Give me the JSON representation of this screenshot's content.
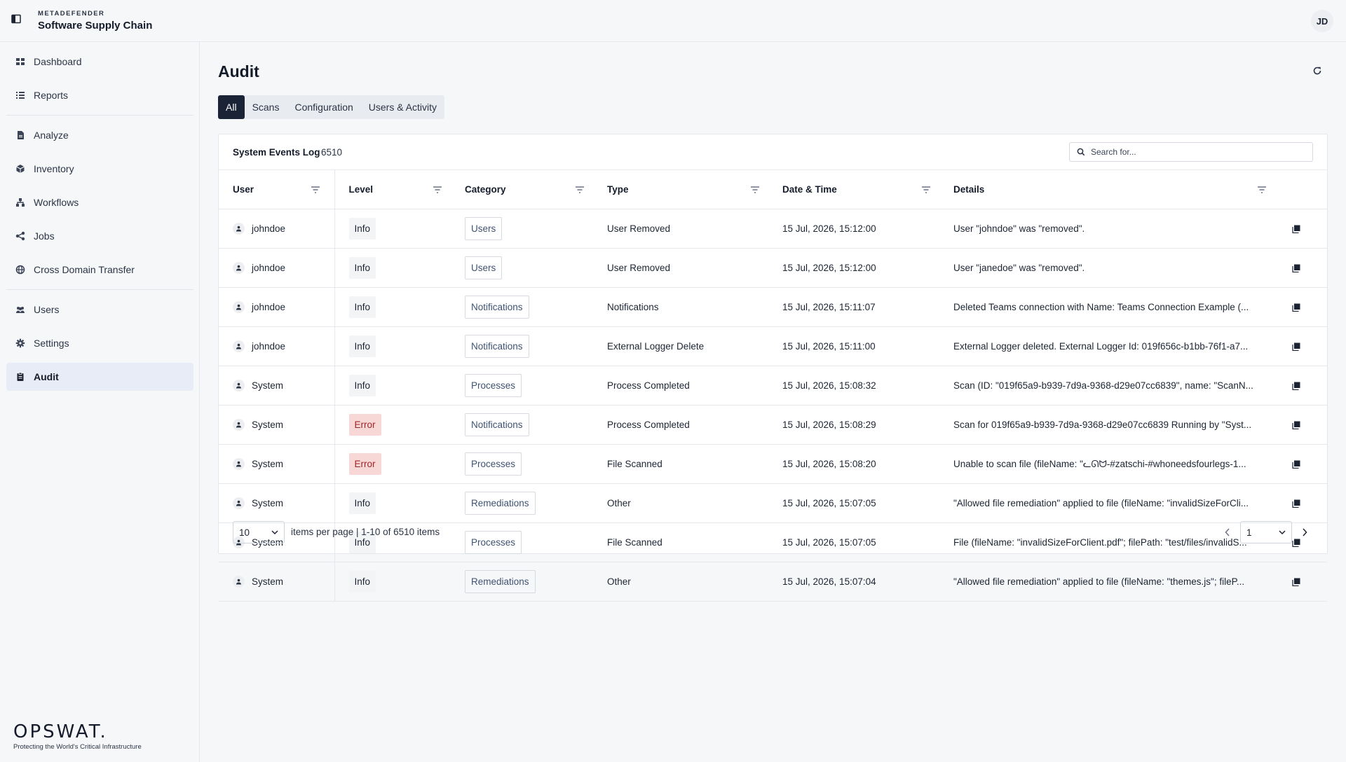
{
  "brand": {
    "over": "METADEFENDER",
    "name": "Software Supply Chain"
  },
  "user_initials": "JD",
  "sidebar": {
    "items": [
      {
        "label": "Dashboard",
        "icon": "dashboard-icon"
      },
      {
        "label": "Reports",
        "icon": "list-icon"
      },
      {
        "label": "Analyze",
        "icon": "document-icon"
      },
      {
        "label": "Inventory",
        "icon": "cube-icon"
      },
      {
        "label": "Workflows",
        "icon": "workflow-icon"
      },
      {
        "label": "Jobs",
        "icon": "share-icon"
      },
      {
        "label": "Cross Domain Transfer",
        "icon": "globe-icon"
      },
      {
        "label": "Users",
        "icon": "users-icon"
      },
      {
        "label": "Settings",
        "icon": "gear-icon"
      },
      {
        "label": "Audit",
        "icon": "clipboard-icon"
      }
    ],
    "active": "Audit"
  },
  "logo": {
    "word": "OPSWAT.",
    "tagline": "Protecting the World's Critical Infrastructure"
  },
  "page": {
    "title": "Audit"
  },
  "tabs": [
    {
      "label": "All",
      "active": true
    },
    {
      "label": "Scans",
      "active": false
    },
    {
      "label": "Configuration",
      "active": false
    },
    {
      "label": "Users & Activity",
      "active": false
    }
  ],
  "log": {
    "title": "System Events Log",
    "count": "6510",
    "search_placeholder": "Search for..."
  },
  "table": {
    "columns": [
      "User",
      "Level",
      "Category",
      "Type",
      "Date & Time",
      "Details"
    ],
    "rows": [
      {
        "user": "johndoe",
        "level": "Info",
        "category": "Users",
        "type": "User Removed",
        "datetime": "15 Jul, 2026, 15:12:00",
        "details": "User \"johndoe\" was \"removed\"."
      },
      {
        "user": "johndoe",
        "level": "Info",
        "category": "Users",
        "type": "User Removed",
        "datetime": "15 Jul, 2026, 15:12:00",
        "details": "User \"janedoe\" was \"removed\"."
      },
      {
        "user": "johndoe",
        "level": "Info",
        "category": "Notifications",
        "type": "Notifications",
        "datetime": "15 Jul, 2026, 15:11:07",
        "details": "Deleted Teams connection with Name: Teams Connection Example (..."
      },
      {
        "user": "johndoe",
        "level": "Info",
        "category": "Notifications",
        "type": "External Logger Delete",
        "datetime": "15 Jul, 2026, 15:11:00",
        "details": "External Logger deleted. External Logger Id: 019f656c-b1bb-76f1-a7..."
      },
      {
        "user": "System",
        "level": "Info",
        "category": "Processes",
        "type": "Process Completed",
        "datetime": "15 Jul, 2026, 15:08:32",
        "details": "Scan (ID: \"019f65a9-b939-7d9a-9368-d29e07cc6839\", name: \"ScanN..."
      },
      {
        "user": "System",
        "level": "Error",
        "category": "Notifications",
        "type": "Process Completed",
        "datetime": "15 Jul, 2026, 15:08:29",
        "details": "Scan for 019f65a9-b939-7d9a-9368-d29e07cc6839 Running by \"Syst..."
      },
      {
        "user": "System",
        "level": "Error",
        "category": "Processes",
        "type": "File Scanned",
        "datetime": "15 Jul, 2026, 15:08:20",
        "details": "Unable to scan file (fileName: \"ᓚᘏᗢ-#zatschi-#whoneedsfourlegs-1..."
      },
      {
        "user": "System",
        "level": "Info",
        "category": "Remediations",
        "type": "Other",
        "datetime": "15 Jul, 2026, 15:07:05",
        "details": "\"Allowed file remediation\" applied to file (fileName: \"invalidSizeForCli..."
      },
      {
        "user": "System",
        "level": "Info",
        "category": "Processes",
        "type": "File Scanned",
        "datetime": "15 Jul, 2026, 15:07:05",
        "details": "File (fileName: \"invalidSizeForClient.pdf\"; filePath: \"test/files/invalidS..."
      },
      {
        "user": "System",
        "level": "Info",
        "category": "Remediations",
        "type": "Other",
        "datetime": "15 Jul, 2026, 15:07:04",
        "details": "\"Allowed file remediation\" applied to file (fileName: \"themes.js\"; fileP..."
      }
    ]
  },
  "pagination": {
    "per_page": "10",
    "summary": "items per page | 1-10 of 6510 items",
    "current_page": "1"
  },
  "colors": {
    "accent": "#1b2336",
    "error_bg": "#f8d7d7",
    "error_text": "#a12626",
    "active_nav": "#e7ecf6"
  }
}
